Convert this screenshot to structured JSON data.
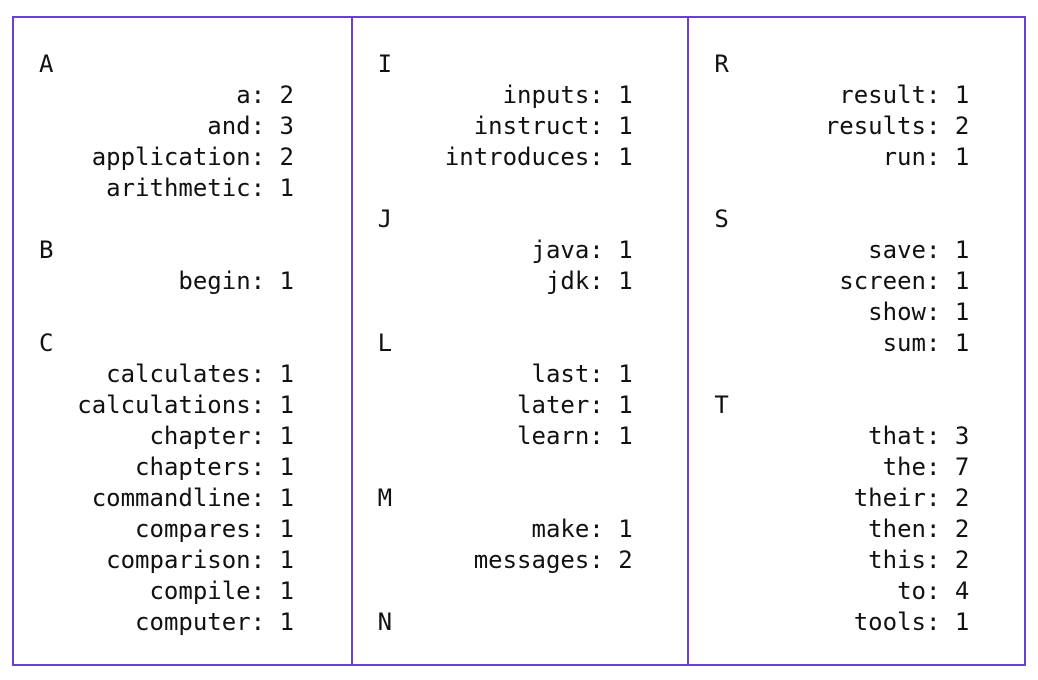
{
  "columns": [
    {
      "groups": [
        {
          "letter": "A",
          "words": [
            {
              "word": "a",
              "count": 2
            },
            {
              "word": "and",
              "count": 3
            },
            {
              "word": "application",
              "count": 2
            },
            {
              "word": "arithmetic",
              "count": 1
            }
          ]
        },
        {
          "letter": "B",
          "words": [
            {
              "word": "begin",
              "count": 1
            }
          ]
        },
        {
          "letter": "C",
          "words": [
            {
              "word": "calculates",
              "count": 1
            },
            {
              "word": "calculations",
              "count": 1
            },
            {
              "word": "chapter",
              "count": 1
            },
            {
              "word": "chapters",
              "count": 1
            },
            {
              "word": "commandline",
              "count": 1
            },
            {
              "word": "compares",
              "count": 1
            },
            {
              "word": "comparison",
              "count": 1
            },
            {
              "word": "compile",
              "count": 1
            },
            {
              "word": "computer",
              "count": 1
            }
          ]
        }
      ]
    },
    {
      "groups": [
        {
          "letter": "I",
          "words": [
            {
              "word": "inputs",
              "count": 1
            },
            {
              "word": "instruct",
              "count": 1
            },
            {
              "word": "introduces",
              "count": 1
            }
          ]
        },
        {
          "letter": "J",
          "words": [
            {
              "word": "java",
              "count": 1
            },
            {
              "word": "jdk",
              "count": 1
            }
          ]
        },
        {
          "letter": "L",
          "words": [
            {
              "word": "last",
              "count": 1
            },
            {
              "word": "later",
              "count": 1
            },
            {
              "word": "learn",
              "count": 1
            }
          ]
        },
        {
          "letter": "M",
          "words": [
            {
              "word": "make",
              "count": 1
            },
            {
              "word": "messages",
              "count": 2
            }
          ]
        },
        {
          "letter": "N",
          "words": []
        }
      ]
    },
    {
      "groups": [
        {
          "letter": "R",
          "words": [
            {
              "word": "result",
              "count": 1
            },
            {
              "word": "results",
              "count": 2
            },
            {
              "word": "run",
              "count": 1
            }
          ]
        },
        {
          "letter": "S",
          "words": [
            {
              "word": "save",
              "count": 1
            },
            {
              "word": "screen",
              "count": 1
            },
            {
              "word": "show",
              "count": 1
            },
            {
              "word": "sum",
              "count": 1
            }
          ]
        },
        {
          "letter": "T",
          "words": [
            {
              "word": "that",
              "count": 3
            },
            {
              "word": "the",
              "count": 7
            },
            {
              "word": "their",
              "count": 2
            },
            {
              "word": "then",
              "count": 2
            },
            {
              "word": "this",
              "count": 2
            },
            {
              "word": "to",
              "count": 4
            },
            {
              "word": "tools",
              "count": 1
            }
          ]
        }
      ]
    }
  ]
}
